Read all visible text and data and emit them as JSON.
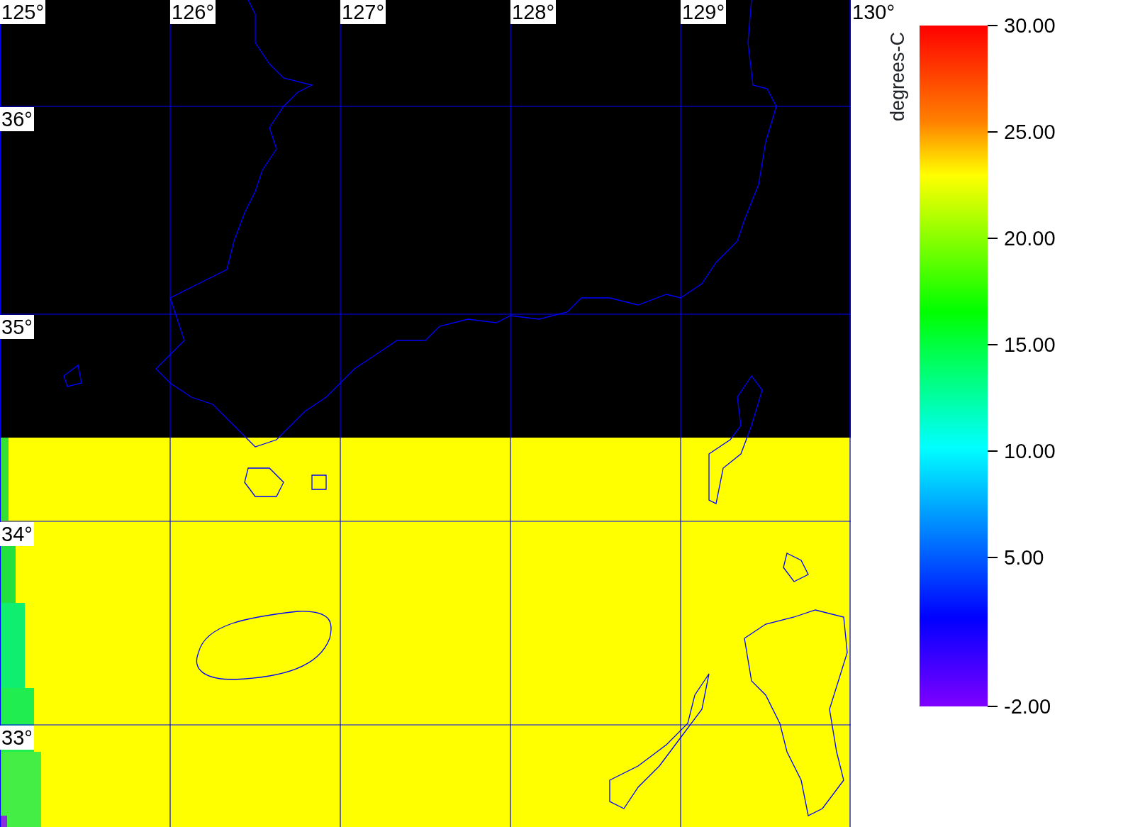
{
  "map": {
    "longitude_labels": [
      "125°",
      "126°",
      "127°",
      "128°",
      "129°",
      "130°"
    ],
    "latitude_labels": [
      "36°",
      "35°",
      "34°",
      "33°"
    ]
  },
  "colorbar": {
    "unit_label": "degrees-C",
    "tick_labels": [
      "30.00",
      "25.00",
      "20.00",
      "15.00",
      "10.00",
      "5.00",
      "-2.00"
    ]
  }
}
